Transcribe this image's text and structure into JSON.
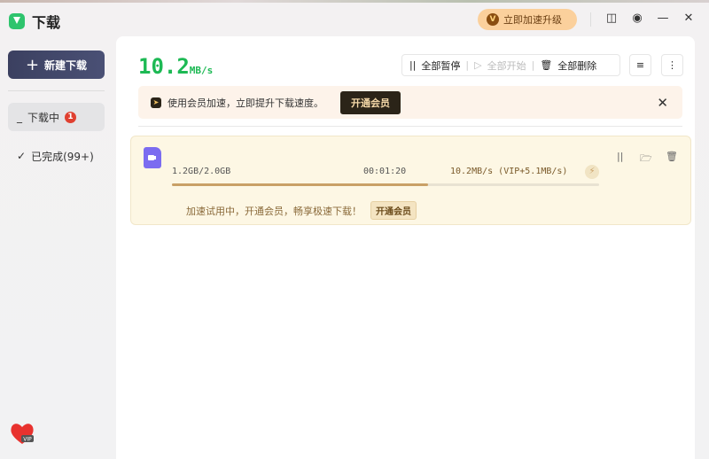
{
  "app": {
    "title": "下载"
  },
  "titlebar": {
    "upgrade_label": "立即加速升级",
    "upgrade_icon": "V"
  },
  "sidebar": {
    "new_download": "新建下载",
    "items": [
      {
        "label": "下载中",
        "badge": "1"
      },
      {
        "label": "已完成(99+)"
      }
    ]
  },
  "main": {
    "speed_value": "10.2",
    "speed_unit": "MB/s",
    "toolbar": {
      "pause_all": "全部暂停",
      "start_all": "全部开始",
      "delete_all": "全部删除"
    },
    "promo": {
      "text": "使用会员加速，立即提升下载速度。",
      "button": "开通会员"
    },
    "tasks": [
      {
        "size": "1.2GB/2.0GB",
        "time": "00:01:20",
        "speed": "10.2MB/s (VIP+5.1MB/s)",
        "progress": 0.6,
        "trial_text": "加速试用中，开通会员，畅享极速下载！",
        "trial_button": "开通会员"
      }
    ]
  },
  "colors": {
    "accent_green": "#1db954",
    "progress": "#c9a066",
    "file_icon": "#7b6cf0"
  }
}
